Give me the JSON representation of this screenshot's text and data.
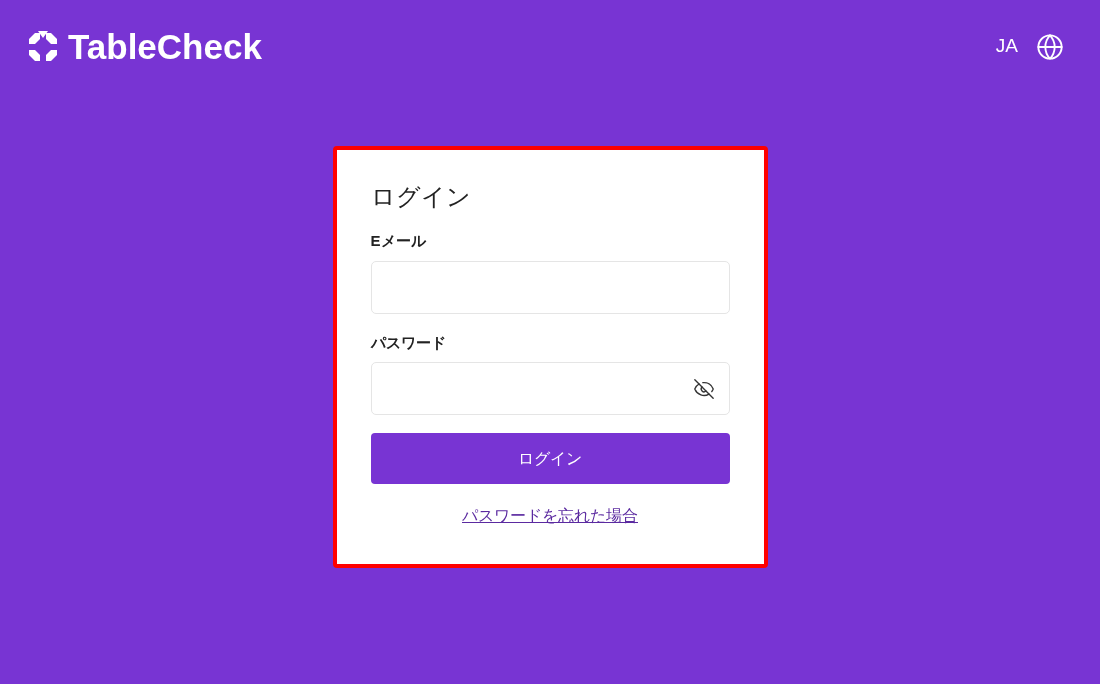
{
  "header": {
    "logo_text": "TableCheck",
    "language": "JA"
  },
  "login_card": {
    "title": "ログイン",
    "fields": [
      {
        "kind": "email",
        "label": "Eメール"
      },
      {
        "kind": "password",
        "label": "パスワード"
      }
    ],
    "submit_button": "ログイン",
    "forgot_link": "パスワードを忘れた場合"
  }
}
